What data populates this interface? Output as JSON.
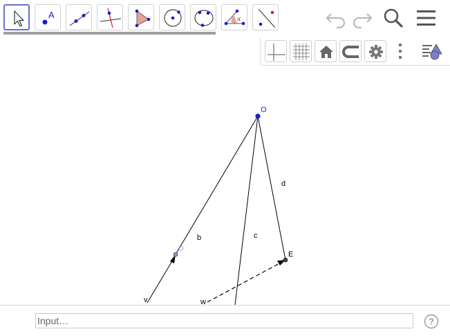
{
  "toolbar": {
    "tools": [
      {
        "name": "move-tool",
        "selected": true
      },
      {
        "name": "point-tool",
        "selected": false
      },
      {
        "name": "line-tool",
        "selected": false
      },
      {
        "name": "perpendicular-line-tool",
        "selected": false
      },
      {
        "name": "polygon-tool",
        "selected": false
      },
      {
        "name": "circle-with-center-tool",
        "selected": false
      },
      {
        "name": "circle-through-points-tool",
        "selected": false
      },
      {
        "name": "angle-tool",
        "selected": false
      },
      {
        "name": "reflect-about-line-tool",
        "selected": false
      }
    ],
    "point_tool_letter": "A",
    "angle_tool_letter": "α",
    "header_icons": [
      "undo-icon",
      "redo-icon",
      "search-icon",
      "menu-icon"
    ]
  },
  "style_bar": {
    "icons": [
      "axes-icon",
      "grid-icon",
      "home-icon",
      "point-capturing-icon",
      "settings-icon",
      "more-icon",
      "toggle-style-bar-icon"
    ]
  },
  "graphics": {
    "point_labels": {
      "O": "O",
      "E": "E"
    },
    "line_labels": {
      "b": "b",
      "c": "c",
      "d": "d"
    },
    "vector_labels": {
      "v": "v",
      "w": "w"
    }
  },
  "input_bar": {
    "placeholder": "Input…",
    "help_label": "?"
  },
  "colors": {
    "accent": "#6b6bd6",
    "point_blue": "#1a1ad6",
    "icon_gray": "#666666",
    "polygon_fill": "#e8a09a"
  }
}
